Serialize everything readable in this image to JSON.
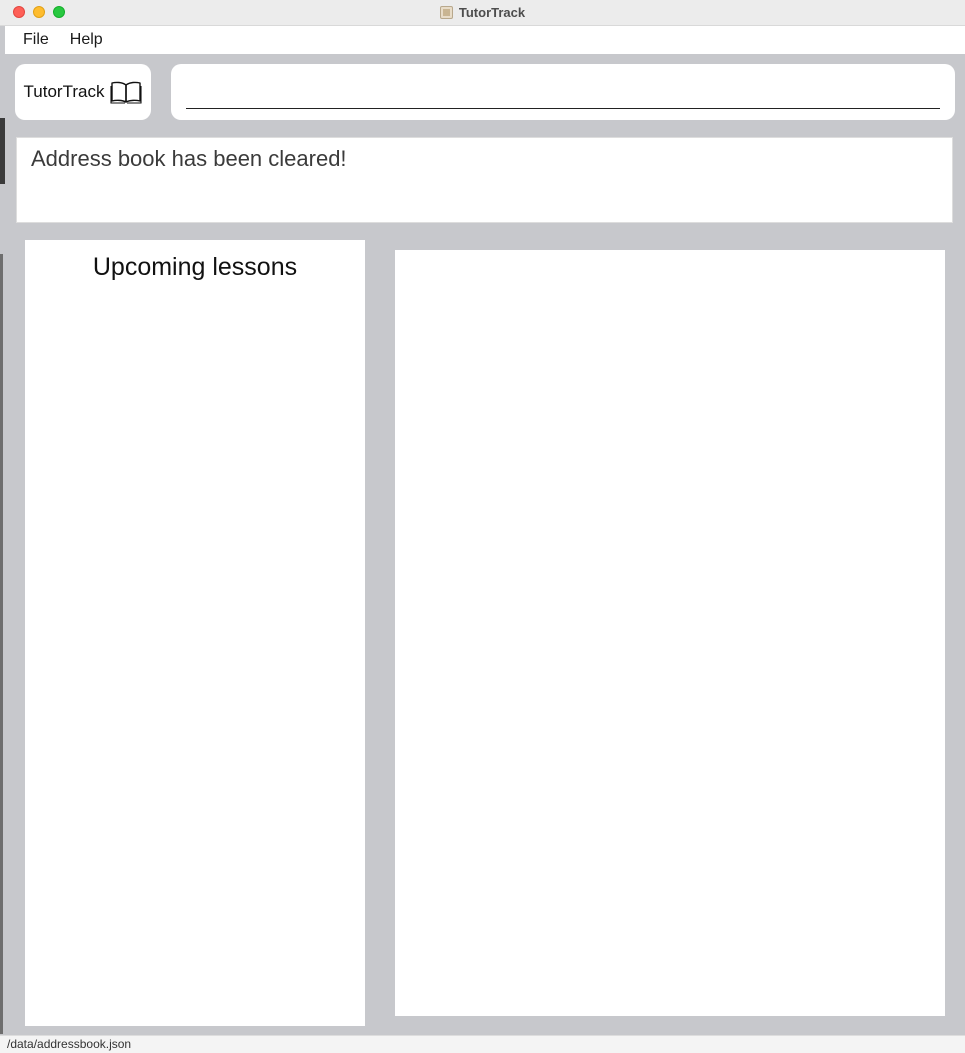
{
  "window": {
    "title": "TutorTrack"
  },
  "menu": {
    "items": [
      {
        "label": "File"
      },
      {
        "label": "Help"
      }
    ]
  },
  "header": {
    "brand_name": "TutorTrack",
    "brand_icon": "open-book-icon"
  },
  "command": {
    "value": "",
    "placeholder": ""
  },
  "result": {
    "message": "Address book has been cleared!"
  },
  "lessons": {
    "title": "Upcoming lessons",
    "items": []
  },
  "person_list": {
    "items": []
  },
  "status": {
    "save_location": "/data/addressbook.json"
  },
  "colors": {
    "background": "#c7c8cc",
    "panel": "#ffffff",
    "close": "#fe5f57",
    "minimize": "#febc2e",
    "maximize": "#28c840"
  }
}
